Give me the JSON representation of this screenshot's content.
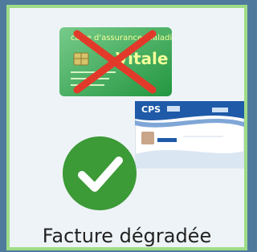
{
  "tile": {
    "label": "Facture dégradée",
    "selected": true
  },
  "vitale_card": {
    "header_text": "carte d'assurance maladie",
    "brand_text": "Vitale",
    "crossed_out": true
  },
  "cps_card": {
    "brand_text": "CPS"
  },
  "status_icon": "checkmark-icon",
  "colors": {
    "tile_border": "#9fdc88",
    "background": "#4f7a9c",
    "vitale_green": "#2fae4c",
    "cross_red": "#e23a2a",
    "check_green": "#3c9a37",
    "cps_blue": "#1e5aa8"
  }
}
